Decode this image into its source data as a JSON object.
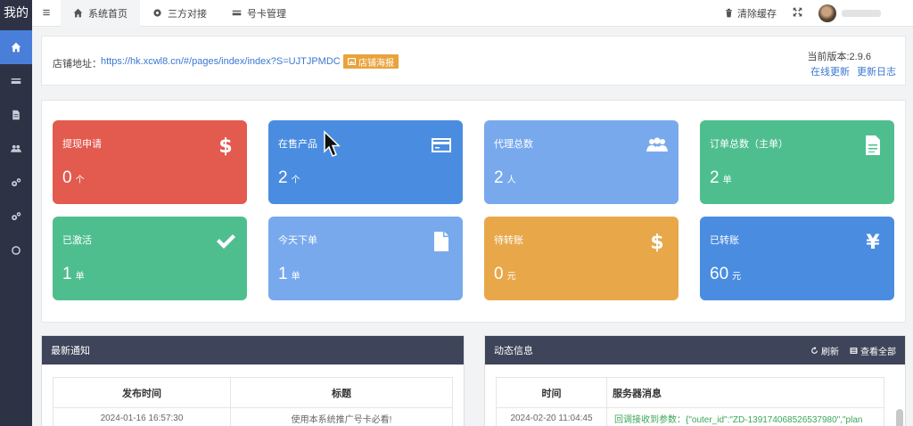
{
  "sidebar": {
    "brand": "我的",
    "items": [
      {
        "icon": "home-icon",
        "active": true
      },
      {
        "icon": "card-icon"
      },
      {
        "icon": "document-icon"
      },
      {
        "icon": "users-icon"
      },
      {
        "icon": "cogs-icon"
      },
      {
        "icon": "cogs-icon"
      },
      {
        "icon": "circle-icon"
      }
    ]
  },
  "topbar": {
    "tabs": [
      {
        "label": "系统首页",
        "icon": "home-icon"
      },
      {
        "label": "三方对接",
        "icon": "gear-icon"
      },
      {
        "label": "号卡管理",
        "icon": "card-icon"
      }
    ],
    "clear_cache": "清除缓存"
  },
  "store": {
    "label": "店铺地址：",
    "url": "https://hk.xcwl8.cn/#/pages/index/index?S=UJTJPMDC",
    "poster_btn": "店铺海报",
    "version": "当前版本:2.9.6",
    "online_update": "在线更新",
    "changelog": "更新日志"
  },
  "cards": [
    {
      "title": "提现申请",
      "value": "0",
      "unit": "个",
      "icon": "dollar-icon",
      "color": "#e35a4f"
    },
    {
      "title": "在售产品",
      "value": "2",
      "unit": "个",
      "icon": "credit-card-icon",
      "color": "#4a8de0"
    },
    {
      "title": "代理总数",
      "value": "2",
      "unit": "人",
      "icon": "users-icon",
      "color": "#78a9ed"
    },
    {
      "title": "订单总数（主单）",
      "value": "2",
      "unit": "单",
      "icon": "file-icon",
      "color": "#4fbe8f"
    },
    {
      "title": "已激活",
      "value": "1",
      "unit": "单",
      "icon": "check-icon",
      "color": "#4fbe8f"
    },
    {
      "title": "今天下单",
      "value": "1",
      "unit": "单",
      "icon": "file-icon",
      "color": "#78a9ed"
    },
    {
      "title": "待转账",
      "value": "0",
      "unit": "元",
      "icon": "dollar-icon",
      "color": "#e8a84a"
    },
    {
      "title": "已转账",
      "value": "60",
      "unit": "元",
      "icon": "yen-icon",
      "color": "#4a8de0"
    }
  ],
  "notice": {
    "title": "最新通知",
    "columns": [
      "发布时间",
      "标题"
    ],
    "rows": [
      [
        "2024-01-16 16:57:30",
        "使用本系统推广号卡必看!"
      ]
    ]
  },
  "activity": {
    "title": "动态信息",
    "refresh": "刷新",
    "view_all": "查看全部",
    "columns": [
      "时间",
      "服务器消息"
    ],
    "rows": [
      [
        "2024-02-20 11:04:45",
        "回调接收到参数：{\"outer_id\":\"ZD-139174068526537980\",\"plan"
      ]
    ]
  }
}
